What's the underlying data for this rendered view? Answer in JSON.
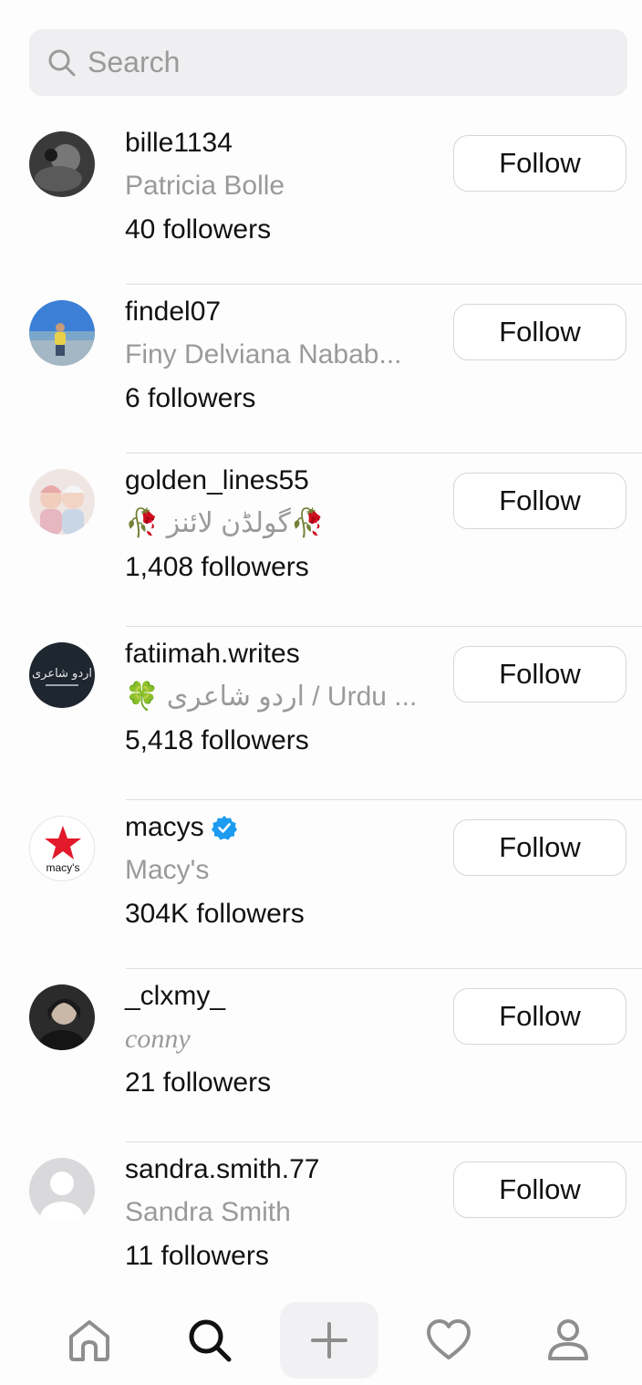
{
  "search": {
    "placeholder": "Search"
  },
  "results": [
    {
      "username": "bille1134",
      "full_name": "Patricia Bolle",
      "followers": "40 followers",
      "button": "Follow",
      "verified": false
    },
    {
      "username": "findel07",
      "full_name": "Finy Delviana Nabab...",
      "followers": "6 followers",
      "button": "Follow",
      "verified": false
    },
    {
      "username": "golden_lines55",
      "full_name": "🥀 گولڈن لائنز🥀",
      "followers": "1,408 followers",
      "button": "Follow",
      "verified": false
    },
    {
      "username": "fatiimah.writes",
      "full_name": "🍀 اردو شاعری / Urdu ...",
      "followers": "5,418 followers",
      "button": "Follow",
      "verified": false
    },
    {
      "username": "macys",
      "full_name": "Macy's",
      "followers": "304K followers",
      "button": "Follow",
      "verified": true
    },
    {
      "username": "_clxmy_",
      "full_name": "conny",
      "followers": "21 followers",
      "button": "Follow",
      "verified": false
    },
    {
      "username": "sandra.smith.77",
      "full_name": "Sandra Smith",
      "followers": "11 followers",
      "button": "Follow",
      "verified": false
    }
  ],
  "avatar_texts": {
    "macys_logo": "macy's",
    "fatiimah_logo": "اردو شاعری"
  },
  "nav": [
    "home-icon",
    "search-icon",
    "plus-icon",
    "heart-icon",
    "profile-icon"
  ],
  "colors": {
    "verified": "#1d9bf0",
    "macys_star": "#e21a2c",
    "secondary_text": "#9a9a9a"
  }
}
